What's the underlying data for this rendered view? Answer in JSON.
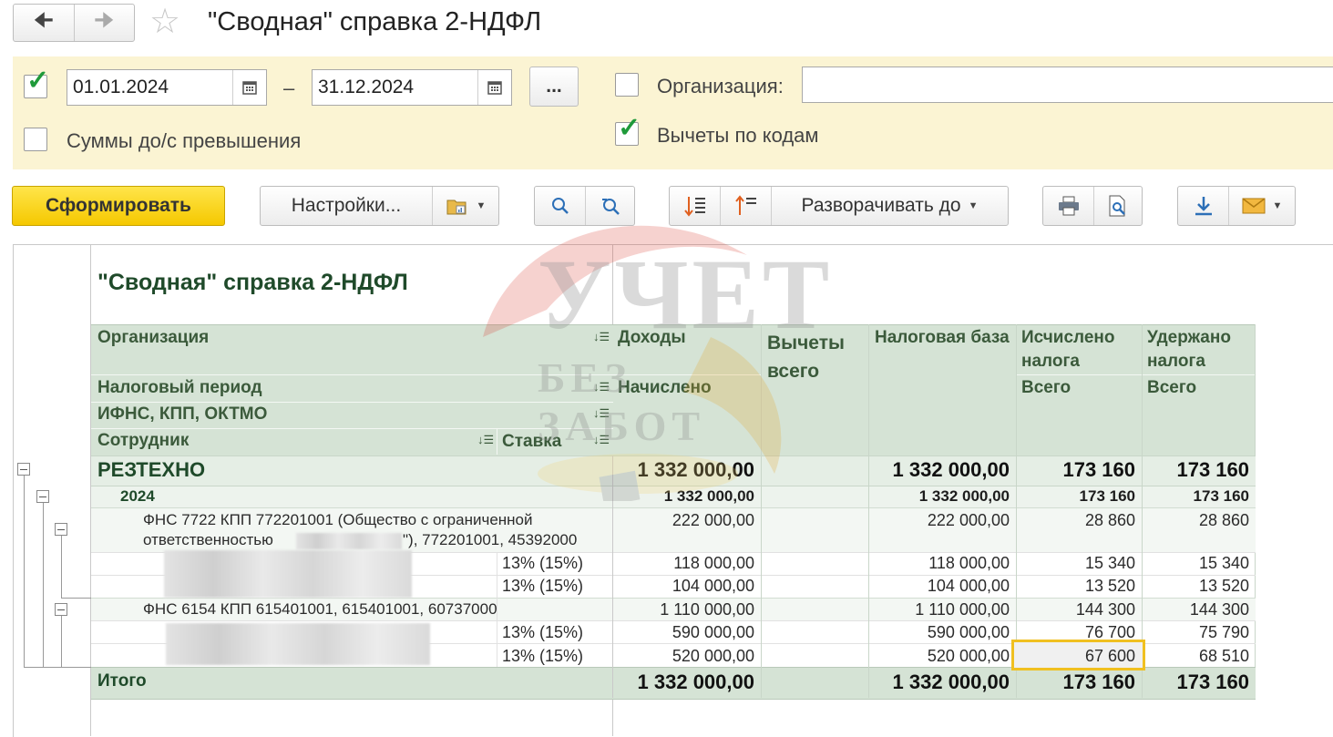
{
  "window": {
    "title": "\"Сводная\" справка 2-НДФЛ"
  },
  "filters": {
    "date_from": "01.01.2024",
    "date_separator": "–",
    "date_to": "31.12.2024",
    "more_label": "...",
    "org_label": "Организация:",
    "org_value": "",
    "sums_label": "Суммы до/с превышения",
    "deductions_label": "Вычеты по кодам"
  },
  "toolbar": {
    "generate_label": "Сформировать",
    "settings_label": "Настройки...",
    "expand_label": "Разворачивать до"
  },
  "watermark": {
    "line1": "УЧЕТ",
    "line2": "БЕЗ ЗАБОТ"
  },
  "report": {
    "title": "\"Сводная\" справка 2-НДФЛ",
    "headers": {
      "org": "Организация",
      "period": "Налоговый период",
      "ifns": "ИФНС, КПП, ОКТМО",
      "employee": "Сотрудник",
      "rate": "Ставка",
      "income": "Доходы",
      "accrued": "Начислено",
      "deductions": "Вычеты всего",
      "base": "Налоговая база",
      "calc": "Исчислено налога",
      "calc_total": "Всего",
      "withheld": "Удержано налога",
      "withheld_total": "Всего"
    },
    "rows": [
      {
        "name": "РЕЗТЕХНО",
        "income": "1 332 000,00",
        "base": "1 332 000,00",
        "calc": "173 160",
        "withheld": "173 160"
      },
      {
        "name": "2024",
        "income": "1 332 000,00",
        "base": "1 332 000,00",
        "calc": "173 160",
        "withheld": "173 160"
      },
      {
        "name1": "ФНС 7722 КПП 772201001 (Общество с ограниченной",
        "name2": "ответственностью",
        "name3": "\"), 772201001, 45392000",
        "income": "222 000,00",
        "base": "222 000,00",
        "calc": "28 860",
        "withheld": "28 860"
      },
      {
        "rate": "13% (15%)",
        "income": "118 000,00",
        "base": "118 000,00",
        "calc": "15 340",
        "withheld": "15 340"
      },
      {
        "rate": "13% (15%)",
        "income": "104 000,00",
        "base": "104 000,00",
        "calc": "13 520",
        "withheld": "13 520"
      },
      {
        "name": "ФНС 6154 КПП 615401001, 615401001, 60737000",
        "income": "1 110 000,00",
        "base": "1 110 000,00",
        "calc": "144 300",
        "withheld": "144 300"
      },
      {
        "rate": "13% (15%)",
        "income": "590 000,00",
        "base": "590 000,00",
        "calc": "76 700",
        "withheld": "75 790"
      },
      {
        "rate": "13% (15%)",
        "income": "520 000,00",
        "base": "520 000,00",
        "calc": "67 600",
        "withheld": "68 510"
      }
    ],
    "total": {
      "label": "Итого",
      "income": "1 332 000,00",
      "base": "1 332 000,00",
      "calc": "173 160",
      "withheld": "173 160"
    }
  },
  "colors": {
    "accent": "#f5c800",
    "header_bg": "#d5e3d5",
    "filter_bg": "#fbf4d3",
    "highlight": "#f0c020"
  }
}
